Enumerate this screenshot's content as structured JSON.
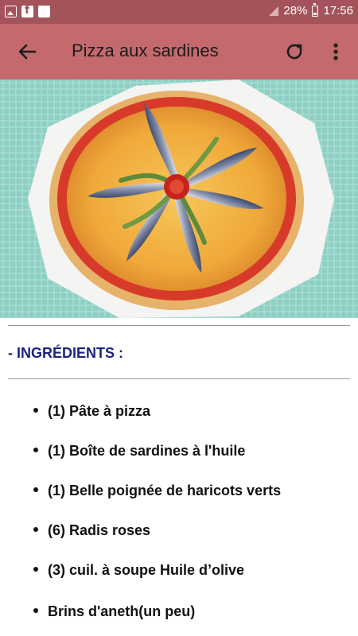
{
  "status_bar": {
    "battery_percent": "28%",
    "time": "17:56",
    "icons": [
      "image-icon",
      "facebook-icon",
      "message-icon",
      "signal-icon",
      "battery-icon"
    ]
  },
  "app_bar": {
    "title": "Pizza aux sardines",
    "back_icon": "arrow-back-icon",
    "refresh_icon": "refresh-icon",
    "more_icon": "more-vertical-icon",
    "color": "#c46a6e"
  },
  "section": {
    "prefix": "- ",
    "heading": "INGRÉDIENTS",
    "suffix": " :",
    "heading_color": "#1a237e"
  },
  "ingredients": [
    "(1) Pâte à pizza",
    "(1) Boîte de sardines à l'huile",
    "(1) Belle poignée de haricots verts",
    "(6) Radis roses",
    "(3) cuil. à soupe Huile d’olive",
    "Brins d'aneth(un peu)"
  ]
}
